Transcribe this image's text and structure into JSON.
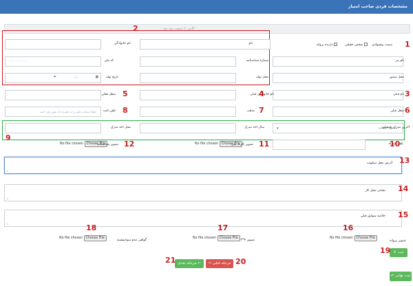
{
  "header": {
    "title": "مشخصات فردی صاحب امتیاز"
  },
  "top_readonly": {
    "text": "گامی تا صفحه بعد بعد"
  },
  "person_type": {
    "label": "سمت پیشنهادی",
    "opt_real": "شخص حقیقی",
    "opt_legal": "دارنده پروانه"
  },
  "fields": {
    "name": {
      "label": "نام"
    },
    "family": {
      "label": "نام خانوادگی"
    },
    "father": {
      "label": "نام پدر"
    },
    "id_no": {
      "label": "شماره شناسنامه"
    },
    "national": {
      "label": "کد ملی",
      "placeholder": "- - - - - - - -"
    },
    "issue_place": {
      "label": "محل صدور"
    },
    "birth_place": {
      "label": "محل تولد"
    },
    "birth_date": {
      "label": "تاریخ تولد",
      "placeholder": "/ /"
    },
    "prev_name": {
      "label": "نام قبلی"
    },
    "prev_family": {
      "label": "نام خانوادگی قبلی"
    },
    "job": {
      "label": "شغل فعلی"
    },
    "prev_job": {
      "label": "شغل قبلی"
    },
    "religion": {
      "label": "مذهب"
    },
    "phone": {
      "label": "تلفن ثابت",
      "placeholder": "لطفاً شماره تلفن را به همراه کد شهر وارد کنید"
    },
    "degree": {
      "label": "آخرین مدرک تحصیلی",
      "value": "بدون انتخاب..."
    },
    "degree_year": {
      "label": "سال اخذ مدرک"
    },
    "degree_place": {
      "label": "محل اخذ مدرک"
    },
    "mobile": {
      "label": "تلفن همراه"
    }
  },
  "files": {
    "no_file": "No file chosen",
    "choose": "Choose File",
    "id_card": "تصویر شناسنامه",
    "national_card": "تصویر کارت ملی",
    "license": "تصویر پروانه",
    "photo": "تصویر ۴*۳",
    "no_record": "گواهی عدم سوءپیشینه"
  },
  "textareas": {
    "home_address": "آدرس محل سکونت",
    "work_address": "نشانی محل کار",
    "background": "خلاصه سوابق قبلی"
  },
  "buttons": {
    "save": "ثبت",
    "final": "ثبت نهایی",
    "prev": "مرحله قبلی",
    "next": "مرحله بعدی"
  },
  "annotations": {
    "n1": "1",
    "n2": "2",
    "n3": "3",
    "n4": "4",
    "n5": "5",
    "n6": "6",
    "n7": "7",
    "n8": "8",
    "n9": "9",
    "n10": "10",
    "n11": "11",
    "n12": "12",
    "n13": "13",
    "n14": "14",
    "n15": "15",
    "n16": "16",
    "n17": "17",
    "n18": "18",
    "n19": "19",
    "n20": "20",
    "n21": "21"
  },
  "colors": {
    "header": "#3a73b8",
    "highlight_red": "#c9141c",
    "highlight_green": "#29a845",
    "save": "#5cb85c",
    "prev": "#d9534f"
  }
}
